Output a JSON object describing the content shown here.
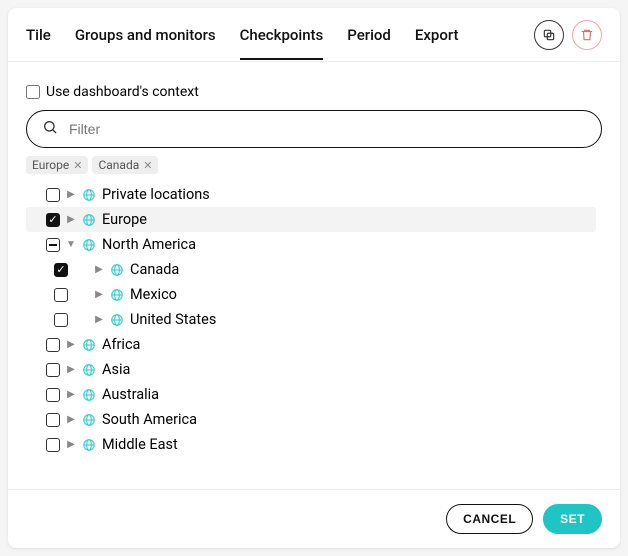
{
  "tabs": {
    "items": [
      "Tile",
      "Groups and monitors",
      "Checkpoints",
      "Period",
      "Export"
    ],
    "activeIndex": 2
  },
  "context": {
    "label": "Use dashboard's context",
    "checked": false
  },
  "filter": {
    "placeholder": "Filter",
    "value": ""
  },
  "chips": [
    "Europe",
    "Canada"
  ],
  "tree": [
    {
      "label": "Private locations",
      "level": 0,
      "state": "unchecked",
      "expanded": false,
      "selected": false
    },
    {
      "label": "Europe",
      "level": 0,
      "state": "checked",
      "expanded": false,
      "selected": true
    },
    {
      "label": "North America",
      "level": 0,
      "state": "indeterminate",
      "expanded": true,
      "selected": false
    },
    {
      "label": "Canada",
      "level": 1,
      "state": "checked",
      "expanded": false,
      "selected": false
    },
    {
      "label": "Mexico",
      "level": 1,
      "state": "unchecked",
      "expanded": false,
      "selected": false
    },
    {
      "label": "United States",
      "level": 1,
      "state": "unchecked",
      "expanded": false,
      "selected": false
    },
    {
      "label": "Africa",
      "level": 0,
      "state": "unchecked",
      "expanded": false,
      "selected": false
    },
    {
      "label": "Asia",
      "level": 0,
      "state": "unchecked",
      "expanded": false,
      "selected": false
    },
    {
      "label": "Australia",
      "level": 0,
      "state": "unchecked",
      "expanded": false,
      "selected": false
    },
    {
      "label": "South America",
      "level": 0,
      "state": "unchecked",
      "expanded": false,
      "selected": false
    },
    {
      "label": "Middle East",
      "level": 0,
      "state": "unchecked",
      "expanded": false,
      "selected": false
    }
  ],
  "footer": {
    "cancel": "CANCEL",
    "set": "SET"
  }
}
